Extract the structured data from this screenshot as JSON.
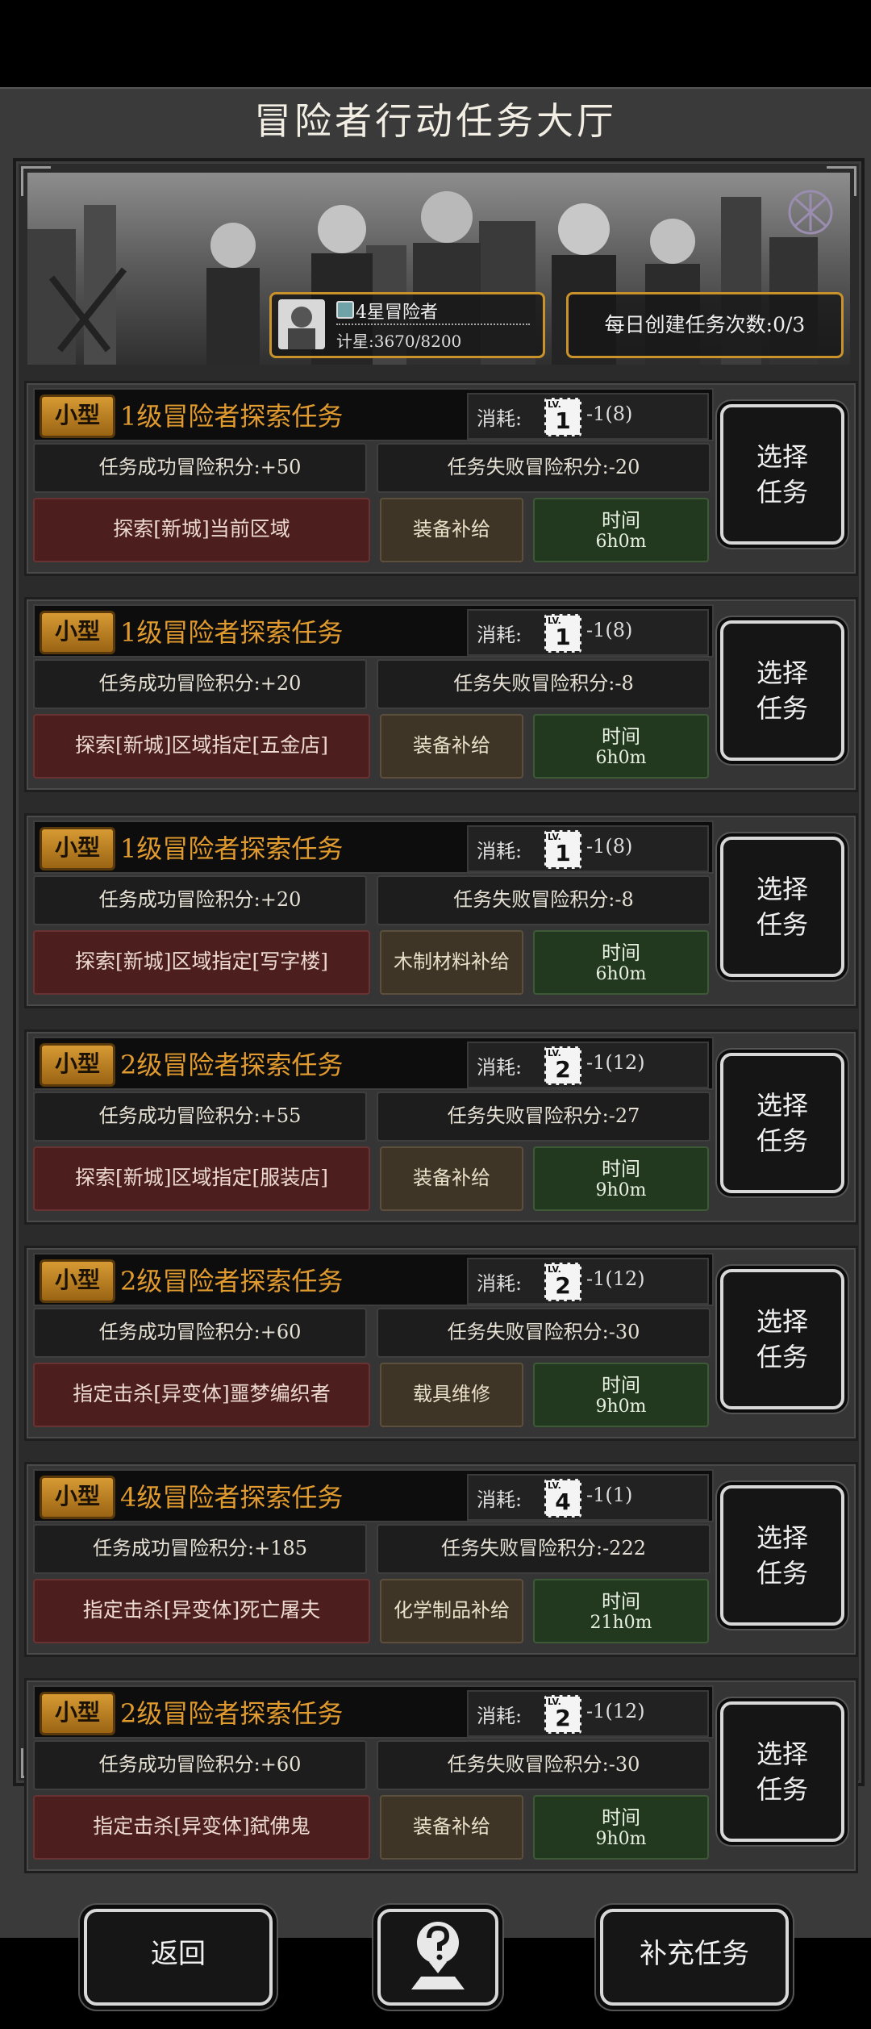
{
  "title": "冒险者行动任务大厅",
  "rank": {
    "title": "4星冒险者",
    "points": "计星:3670/8200"
  },
  "daily": "每日创建任务次数:0/3",
  "tasks": [
    {
      "size": "小型",
      "name": "1级冒险者探索任务",
      "cost_label": "消耗:",
      "lv": "LV.",
      "level": "1",
      "cost": "-1(8)",
      "success": "任务成功冒险积分:+50",
      "fail": "任务失败冒险积分:-20",
      "target": "探索[新城]当前区域",
      "supply": "装备补给",
      "time_label": "时间",
      "time": "6h0m",
      "select": [
        "选择",
        "任务"
      ]
    },
    {
      "size": "小型",
      "name": "1级冒险者探索任务",
      "cost_label": "消耗:",
      "lv": "LV.",
      "level": "1",
      "cost": "-1(8)",
      "success": "任务成功冒险积分:+20",
      "fail": "任务失败冒险积分:-8",
      "target": "探索[新城]区域指定[五金店]",
      "supply": "装备补给",
      "time_label": "时间",
      "time": "6h0m",
      "select": [
        "选择",
        "任务"
      ]
    },
    {
      "size": "小型",
      "name": "1级冒险者探索任务",
      "cost_label": "消耗:",
      "lv": "LV.",
      "level": "1",
      "cost": "-1(8)",
      "success": "任务成功冒险积分:+20",
      "fail": "任务失败冒险积分:-8",
      "target": "探索[新城]区域指定[写字楼]",
      "supply": "木制材料补给",
      "time_label": "时间",
      "time": "6h0m",
      "select": [
        "选择",
        "任务"
      ]
    },
    {
      "size": "小型",
      "name": "2级冒险者探索任务",
      "cost_label": "消耗:",
      "lv": "LV.",
      "level": "2",
      "cost": "-1(12)",
      "success": "任务成功冒险积分:+55",
      "fail": "任务失败冒险积分:-27",
      "target": "探索[新城]区域指定[服装店]",
      "supply": "装备补给",
      "time_label": "时间",
      "time": "9h0m",
      "select": [
        "选择",
        "任务"
      ]
    },
    {
      "size": "小型",
      "name": "2级冒险者探索任务",
      "cost_label": "消耗:",
      "lv": "LV.",
      "level": "2",
      "cost": "-1(12)",
      "success": "任务成功冒险积分:+60",
      "fail": "任务失败冒险积分:-30",
      "target": "指定击杀[异变体]噩梦编织者",
      "supply": "载具维修",
      "time_label": "时间",
      "time": "9h0m",
      "select": [
        "选择",
        "任务"
      ]
    },
    {
      "size": "小型",
      "name": "4级冒险者探索任务",
      "cost_label": "消耗:",
      "lv": "LV.",
      "level": "4",
      "cost": "-1(1)",
      "success": "任务成功冒险积分:+185",
      "fail": "任务失败冒险积分:-222",
      "target": "指定击杀[异变体]死亡屠夫",
      "supply": "化学制品补给",
      "time_label": "时间",
      "time": "21h0m",
      "select": [
        "选择",
        "任务"
      ]
    },
    {
      "size": "小型",
      "name": "2级冒险者探索任务",
      "cost_label": "消耗:",
      "lv": "LV.",
      "level": "2",
      "cost": "-1(12)",
      "success": "任务成功冒险积分:+60",
      "fail": "任务失败冒险积分:-30",
      "target": "指定击杀[异变体]弑佛鬼",
      "supply": "装备补给",
      "time_label": "时间",
      "time": "9h0m",
      "select": [
        "选择",
        "任务"
      ]
    }
  ],
  "footer": {
    "back": "返回",
    "help_icon": "question-map-icon",
    "supplement": "补充任务"
  },
  "colors": {
    "accent": "#c9922a",
    "task_name": "#e09a2e",
    "target_bg": "#4d1e1e",
    "supply_bg": "#3f3527",
    "time_bg": "#23391f"
  }
}
